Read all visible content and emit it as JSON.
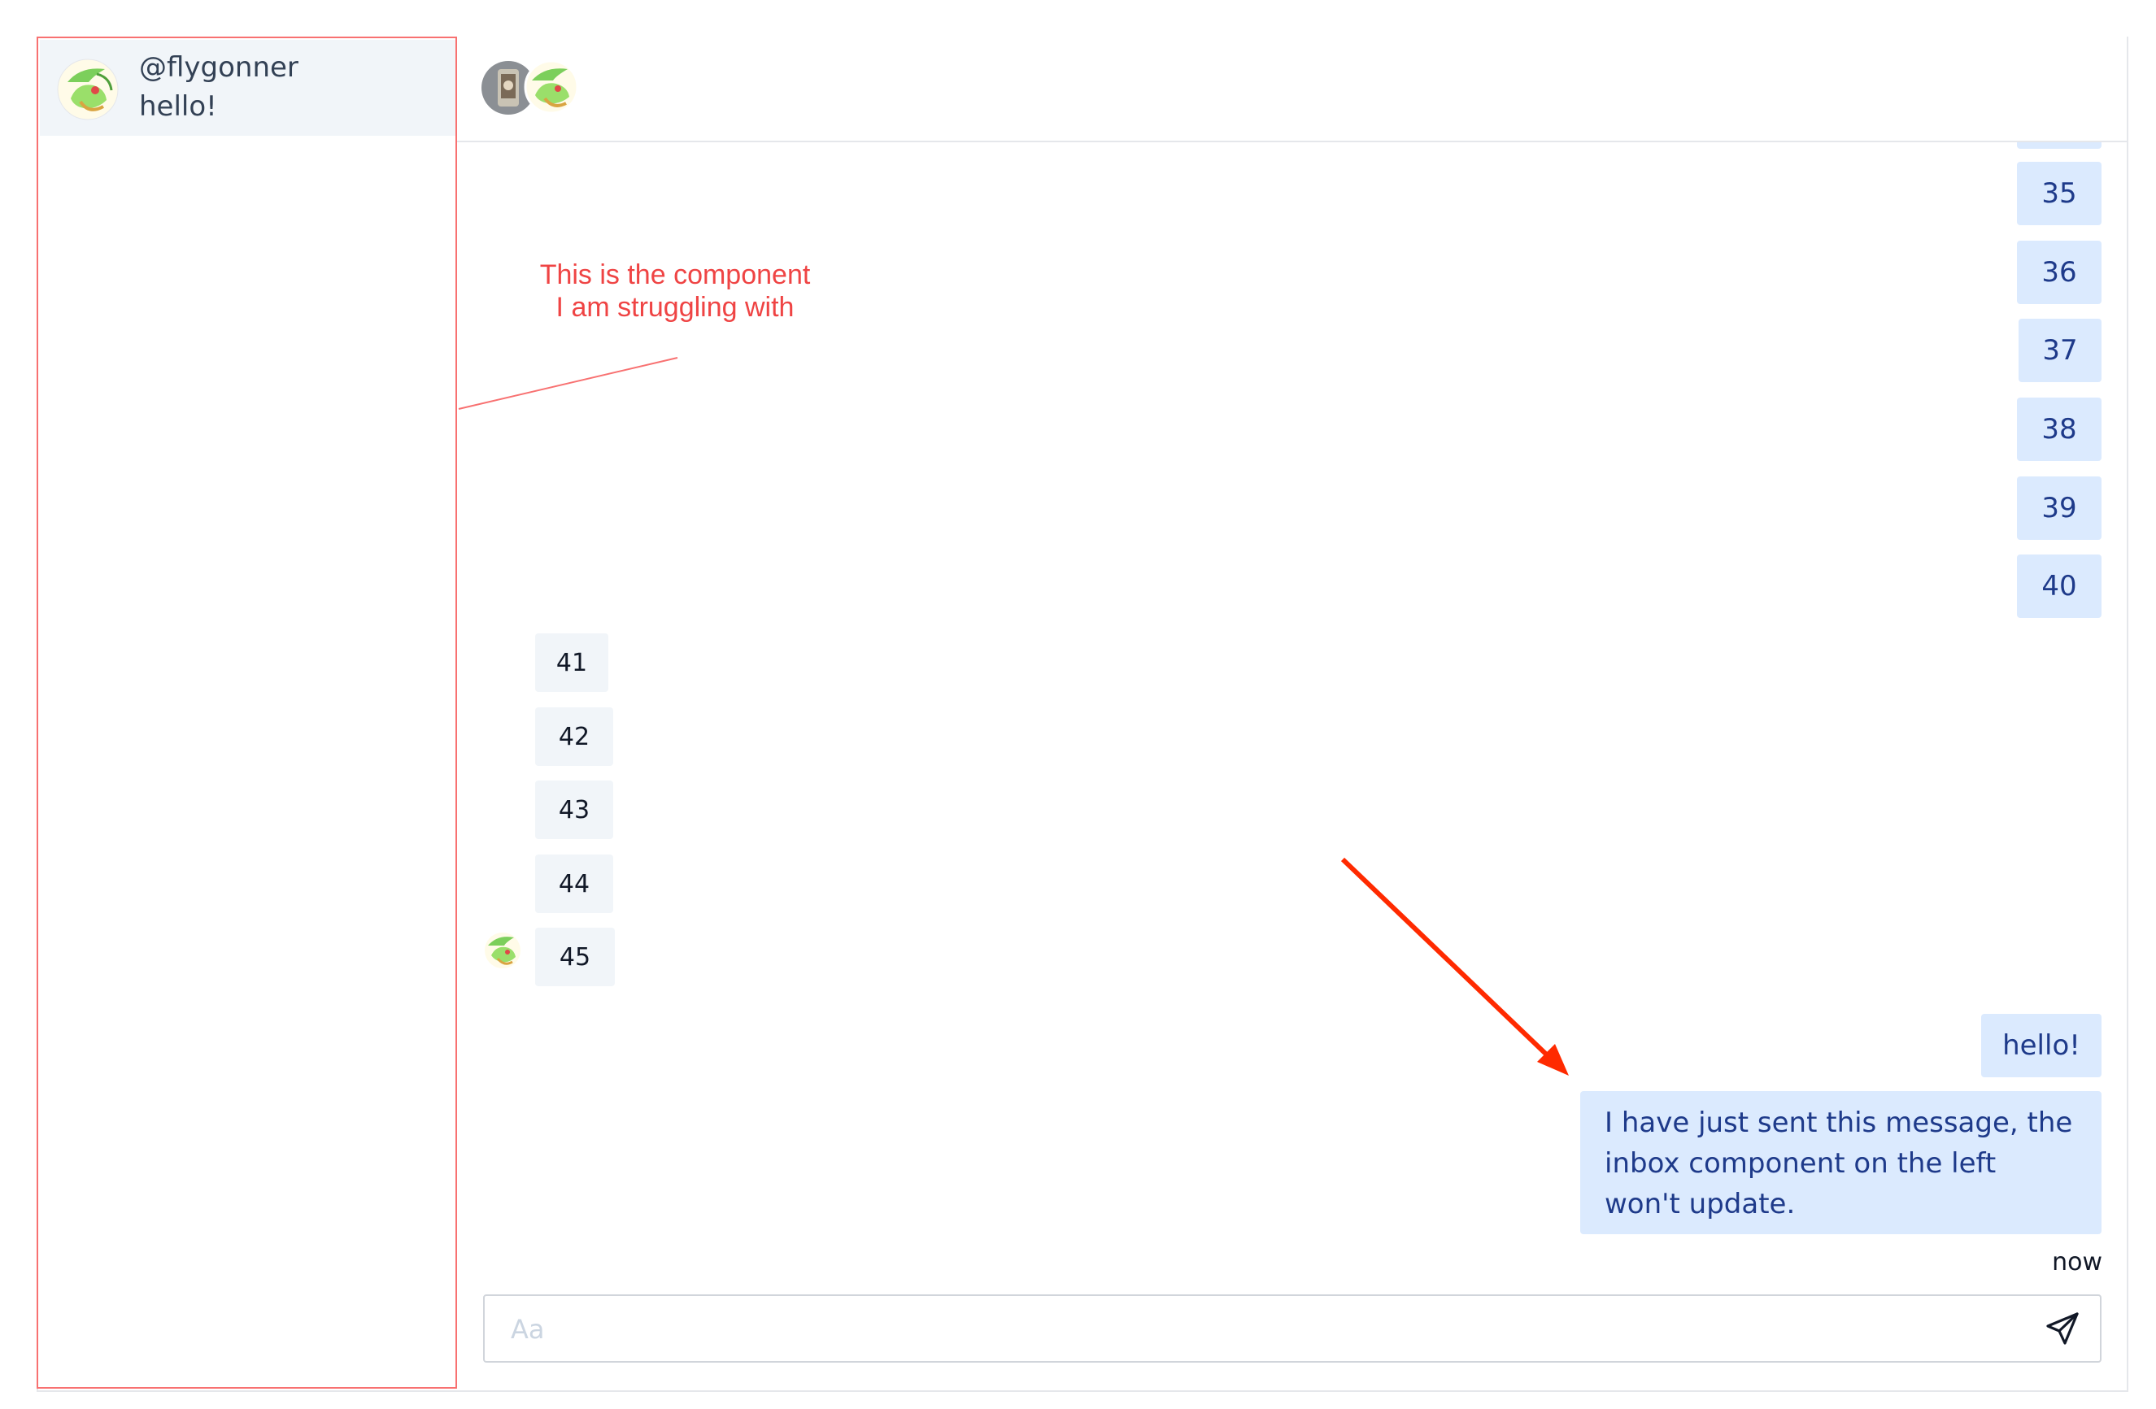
{
  "inbox": {
    "items": [
      {
        "handle": "@flygonner",
        "preview": "hello!"
      }
    ]
  },
  "chat": {
    "outgoing_numbers": [
      "35",
      "36",
      "37",
      "38",
      "39",
      "40"
    ],
    "incoming_numbers": [
      "41",
      "42",
      "43",
      "44",
      "45"
    ],
    "outgoing_messages": [
      "hello!",
      "I have just sent this message, the inbox component on the left won't update."
    ],
    "timestamp": "now"
  },
  "composer": {
    "placeholder": "Aa"
  },
  "annotation": {
    "line1": "This is the component",
    "line2": "I am struggling with"
  },
  "colors": {
    "outgoing_bubble": "#dbeafe",
    "outgoing_text": "#1e3a8a",
    "incoming_bubble": "#f1f5f9",
    "annotation": "#ef4444",
    "arrow": "#ff2a00"
  },
  "icons": {
    "send": "send-icon",
    "avatar": "flygon-avatar-icon"
  }
}
